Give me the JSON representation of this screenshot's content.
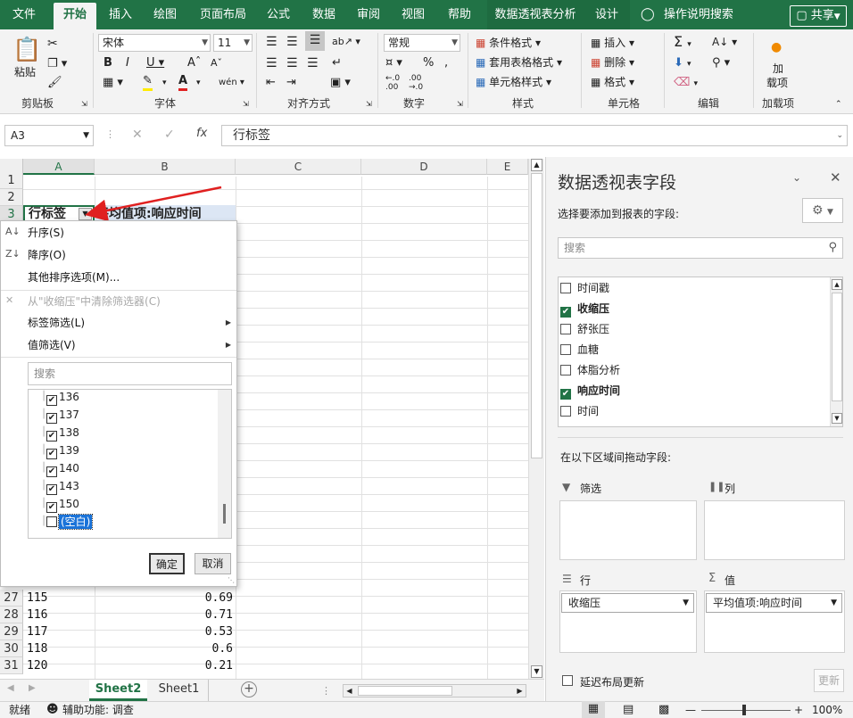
{
  "ribbon_tabs": [
    "文件",
    "开始",
    "插入",
    "绘图",
    "页面布局",
    "公式",
    "数据",
    "审阅",
    "视图",
    "帮助",
    "数据透视表分析",
    "设计"
  ],
  "active_tab": "开始",
  "tell_me": "操作说明搜索",
  "share": "共享",
  "ribbon": {
    "clipboard": {
      "label": "剪贴板",
      "paste": "粘贴"
    },
    "font": {
      "label": "字体",
      "name": "宋体",
      "size": "11"
    },
    "alignment": {
      "label": "对齐方式"
    },
    "number": {
      "label": "数字",
      "format": "常规",
      "percent": "%"
    },
    "styles": {
      "label": "样式",
      "cond_format": "条件格式",
      "table_format": "套用表格格式",
      "cell_styles": "单元格样式"
    },
    "cells": {
      "label": "单元格",
      "insert": "插入",
      "delete": "删除",
      "format": "格式"
    },
    "editing": {
      "label": "编辑"
    },
    "addins": {
      "label": "加载项",
      "btn_line1": "加",
      "btn_line2": "载项"
    }
  },
  "name_box": "A3",
  "formula": "行标签",
  "columns": [
    "A",
    "B",
    "C",
    "D",
    "E"
  ],
  "rows_top": [
    "1",
    "2",
    "3"
  ],
  "header_cells": {
    "a3": "行标签",
    "b3": "平均值项:响应时间"
  },
  "rows_bottom": [
    {
      "n": "27",
      "a": "115",
      "b": "0.69"
    },
    {
      "n": "28",
      "a": "116",
      "b": "0.71"
    },
    {
      "n": "29",
      "a": "117",
      "b": "0.53"
    },
    {
      "n": "30",
      "a": "118",
      "b": "0.6"
    },
    {
      "n": "31",
      "a": "120",
      "b": "0.21"
    }
  ],
  "filter_menu": {
    "sort_asc": "升序(S)",
    "sort_desc": "降序(O)",
    "more_sort": "其他排序选项(M)...",
    "clear_filter": "从\"收缩压\"中清除筛选器(C)",
    "label_filter": "标签筛选(L)",
    "value_filter": "值筛选(V)",
    "search_placeholder": "搜索",
    "items": [
      {
        "label": "136",
        "checked": true
      },
      {
        "label": "137",
        "checked": true
      },
      {
        "label": "138",
        "checked": true
      },
      {
        "label": "139",
        "checked": true
      },
      {
        "label": "140",
        "checked": true
      },
      {
        "label": "143",
        "checked": true
      },
      {
        "label": "150",
        "checked": true
      },
      {
        "label": "(空白)",
        "checked": false
      }
    ],
    "ok": "确定",
    "cancel": "取消"
  },
  "sheets": [
    "Sheet2",
    "Sheet1"
  ],
  "active_sheet": "Sheet2",
  "pivot_panel": {
    "title": "数据透视表字段",
    "choose_label": "选择要添加到报表的字段:",
    "search_placeholder": "搜索",
    "fields": [
      {
        "label": "时间戳",
        "checked": false
      },
      {
        "label": "收缩压",
        "checked": true
      },
      {
        "label": "舒张压",
        "checked": false
      },
      {
        "label": "血糖",
        "checked": false
      },
      {
        "label": "体脂分析",
        "checked": false
      },
      {
        "label": "响应时间",
        "checked": true
      },
      {
        "label": "时间",
        "checked": false
      }
    ],
    "drag_label": "在以下区域间拖动字段:",
    "filters_label": "筛选",
    "columns_label": "列",
    "rows_label": "行",
    "values_label": "值",
    "row_field": "收缩压",
    "value_field": "平均值项:响应时间",
    "defer_label": "延迟布局更新",
    "update_btn": "更新"
  },
  "status": {
    "ready": "就绪",
    "accessibility": "辅助功能: 调查",
    "zoom": "100%"
  },
  "colors": {
    "accent": "#217346",
    "arrow": "#e02020",
    "selection": "#1a73d9"
  }
}
